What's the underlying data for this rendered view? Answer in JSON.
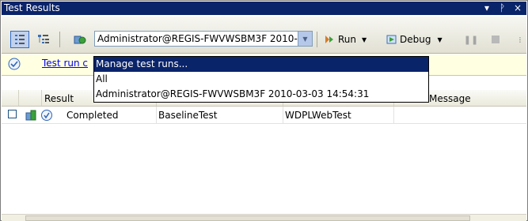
{
  "window": {
    "title": "Test Results",
    "controls": {
      "dropdown": "▾",
      "pin": "ᚹ",
      "close": "×"
    }
  },
  "toolbar": {
    "run_selector": {
      "value": "Administrator@REGIS-FWVWSBM3F 2010-03-03 14:54:31"
    },
    "run_label": "Run",
    "debug_label": "Debug"
  },
  "infobar": {
    "link_text": "Test run c"
  },
  "dropdown": {
    "options": [
      "Manage test runs...",
      "All",
      "Administrator@REGIS-FWVWSBM3F 2010-03-03 14:54:31"
    ],
    "selected_index": 0
  },
  "grid": {
    "columns": [
      "Result",
      "Message"
    ],
    "rows": [
      {
        "result": "Completed",
        "test_name": "BaselineTest",
        "project": "WDPLWebTest",
        "message": ""
      }
    ]
  },
  "colors": {
    "titlebar": "#0a246a",
    "selection": "#0a246a",
    "infobar": "#ffffe1",
    "link": "#0000ee"
  }
}
